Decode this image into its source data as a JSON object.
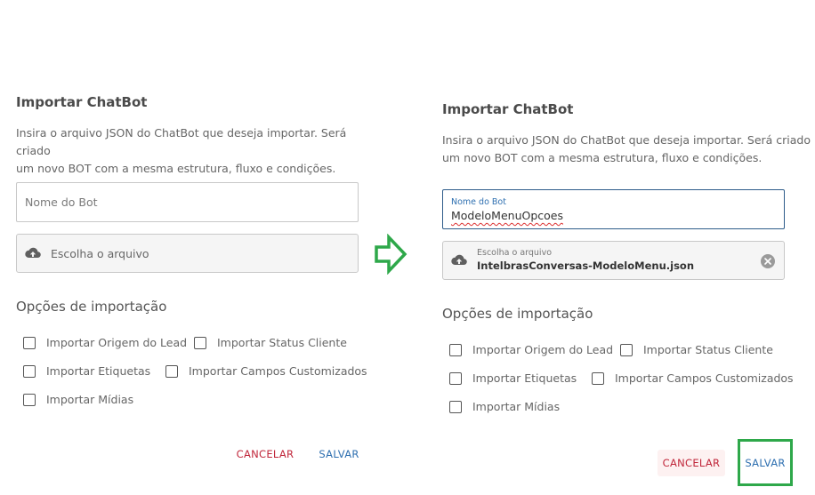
{
  "left": {
    "title": "Importar ChatBot",
    "desc_line1": "Insira o arquivo JSON do ChatBot que deseja importar. Será criado",
    "desc_line2": "um novo BOT com a mesma estrutura, fluxo e condições.",
    "bot_name_placeholder": "Nome do Bot",
    "file_placeholder": "Escolha o arquivo",
    "options_title": "Opções de importação",
    "options": {
      "origem": "Importar Origem do Lead",
      "status": "Importar Status Cliente",
      "etiquetas": "Importar Etiquetas",
      "campos": "Importar Campos Customizados",
      "midias": "Importar Mídias"
    },
    "cancel": "CANCELAR",
    "save": "SALVAR"
  },
  "right": {
    "title": "Importar ChatBot",
    "desc_line1": "Insira o arquivo JSON do ChatBot que deseja importar. Será criado",
    "desc_line2": "um novo BOT com a mesma estrutura, fluxo e condições.",
    "bot_name_label": "Nome do Bot",
    "bot_name_value": "ModeloMenuOpcoes",
    "file_label": "Escolha o arquivo",
    "file_value": "IntelbrasConversas-ModeloMenu.json",
    "options_title": "Opções de importação",
    "options": {
      "origem": "Importar Origem do Lead",
      "status": "Importar Status Cliente",
      "etiquetas": "Importar Etiquetas",
      "campos": "Importar Campos Customizados",
      "midias": "Importar Mídias"
    },
    "cancel": "CANCELAR",
    "save": "SALVAR"
  },
  "colors": {
    "accent_blue": "#2e6fb0",
    "cancel_red": "#c0263a",
    "highlight_green": "#2ea84a"
  },
  "icons": [
    "cloud-upload-icon",
    "clear-icon",
    "arrow-right-icon"
  ]
}
